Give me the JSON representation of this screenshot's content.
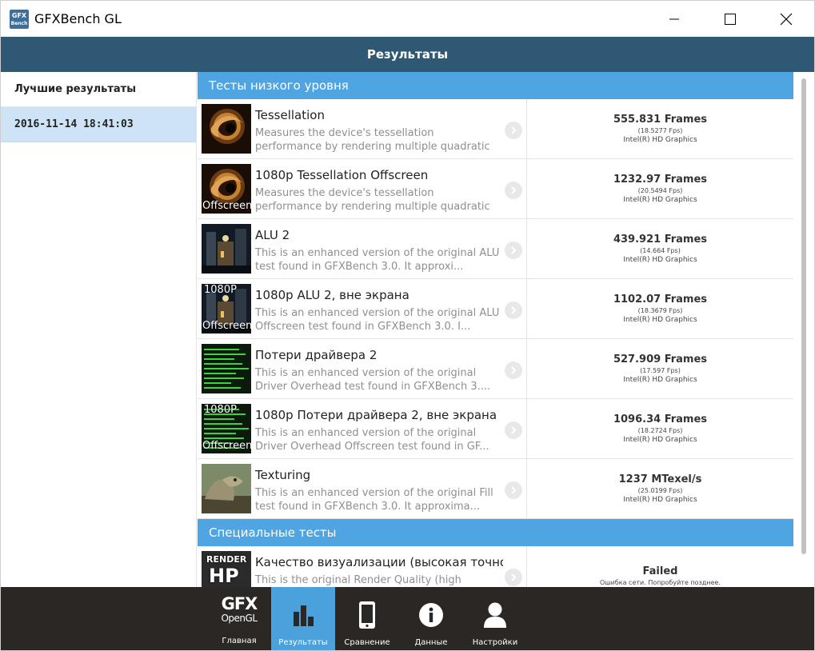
{
  "window": {
    "title": "GFXBench GL",
    "icon_text": "GFX",
    "icon_subtext": "Bench"
  },
  "header": {
    "title": "Результаты"
  },
  "sidebar": {
    "heading": "Лучшие результаты",
    "items": [
      {
        "label": "2016-11-14 18:41:03",
        "selected": true
      }
    ]
  },
  "sections": [
    {
      "title": "Тесты низкого уровня",
      "tests": [
        {
          "name": "Tessellation",
          "description": "Measures the device's tessellation performance by rendering multiple quadratic Bézier s...",
          "score": "555.831 Frames",
          "fps": "(18.5277 Fps)",
          "gpu": "Intel(R) HD Graphics",
          "thumb": "tessellation",
          "tag": ""
        },
        {
          "name": "1080p Tessellation Offscreen",
          "description": "Measures the device's tessellation performance by rendering multiple quadratic Bézier s...",
          "score": "1232.97 Frames",
          "fps": "(20.5494 Fps)",
          "gpu": "Intel(R) HD Graphics",
          "thumb": "tessellation",
          "tag": "Offscreen"
        },
        {
          "name": "ALU 2",
          "description": "This is an enhanced version of the original ALU test found in GFXBench 3.0. It approxi...",
          "score": "439.921 Frames",
          "fps": "(14.664 Fps)",
          "gpu": "Intel(R) HD Graphics",
          "thumb": "alu",
          "tag": ""
        },
        {
          "name": "1080p ALU 2, вне экрана",
          "description": "This is an enhanced version of the original ALU Offscreen test found in GFXBench 3.0. I...",
          "score": "1102.07 Frames",
          "fps": "(18.3679 Fps)",
          "gpu": "Intel(R) HD Graphics",
          "thumb": "alu",
          "tag": "Offscreen",
          "tag_top": "1080P"
        },
        {
          "name": "Потери драйвера 2",
          "description": "This is an enhanced version of the original Driver Overhead test found in GFXBench 3....",
          "score": "527.909 Frames",
          "fps": "(17.597 Fps)",
          "gpu": "Intel(R) HD Graphics",
          "thumb": "driver",
          "tag": ""
        },
        {
          "name": "1080p Потери драйвера 2, вне экрана",
          "description": "This is an enhanced version of the original Driver Overhead Offscreen test found in GF...",
          "score": "1096.34 Frames",
          "fps": "(18.2724 Fps)",
          "gpu": "Intel(R) HD Graphics",
          "thumb": "driver",
          "tag": "Offscreen",
          "tag_top": "1080P"
        },
        {
          "name": "Texturing",
          "description": "This is an enhanced version of the original Fill test found in GFXBench 3.0. It approxima...",
          "score": "1237 MTexel/s",
          "fps": "(25.0199 Fps)",
          "gpu": "Intel(R) HD Graphics",
          "thumb": "texturing",
          "tag": ""
        }
      ]
    },
    {
      "title": "Специальные тесты",
      "tests": [
        {
          "name": "Качество визуализации (высокая точно...",
          "description": "This is the original Render Quality (high precision)...",
          "score": "Failed",
          "fps": "Ошибка сети. Попробуйте позднее.",
          "gpu": "",
          "thumb": "render",
          "tag": "",
          "thumb_text_1": "RENDER",
          "thumb_text_2": "HP"
        }
      ]
    }
  ],
  "bottom_nav": {
    "logo_big": "GFX",
    "logo_small": "OpenGL",
    "items": [
      {
        "label": "Главная",
        "icon": "gfx-logo-icon",
        "active": false
      },
      {
        "label": "Результаты",
        "icon": "bar-chart-icon",
        "active": true
      },
      {
        "label": "Сравнение",
        "icon": "phone-icon",
        "active": false
      },
      {
        "label": "Данные",
        "icon": "info-icon",
        "active": false
      },
      {
        "label": "Настройки",
        "icon": "user-icon",
        "active": false
      }
    ]
  },
  "colors": {
    "header_bg": "#2f5875",
    "section_bg": "#4fa5e2",
    "selected_bg": "#cfe3f7",
    "nav_bg": "#2b2724",
    "nav_active": "#4aa1dc"
  }
}
